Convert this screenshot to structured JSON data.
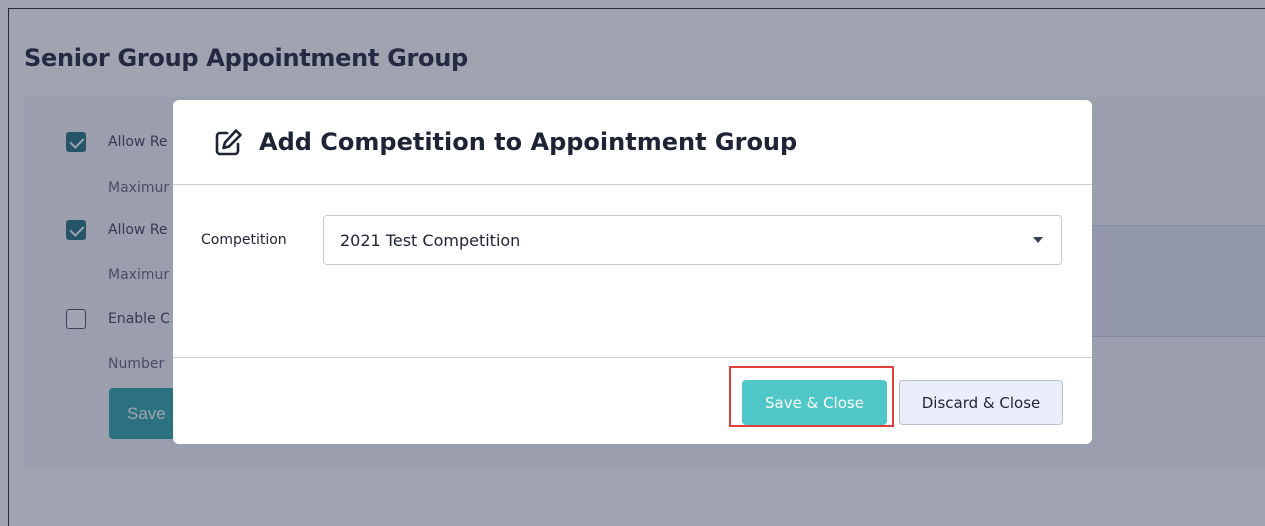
{
  "page": {
    "title": "Senior Group Appointment Group"
  },
  "background_settings": {
    "rows": [
      {
        "label": "Allow Re",
        "checked": true
      },
      {
        "hint": "Maximur"
      },
      {
        "label": "Allow Re",
        "checked": true
      },
      {
        "hint": "Maximur"
      },
      {
        "label": "Enable C",
        "checked": false
      },
      {
        "hint": "Number"
      }
    ],
    "save_label": "Save"
  },
  "modal": {
    "title": "Add Competition to Appointment Group",
    "icon": "edit-icon",
    "competition_label": "Competition",
    "competition_value": "2021 Test Competition",
    "save_label": "Save & Close",
    "discard_label": "Discard & Close"
  },
  "colors": {
    "accent": "#4fc7c8",
    "highlight": "#e0403a",
    "checkbox": "#1f6f78"
  }
}
